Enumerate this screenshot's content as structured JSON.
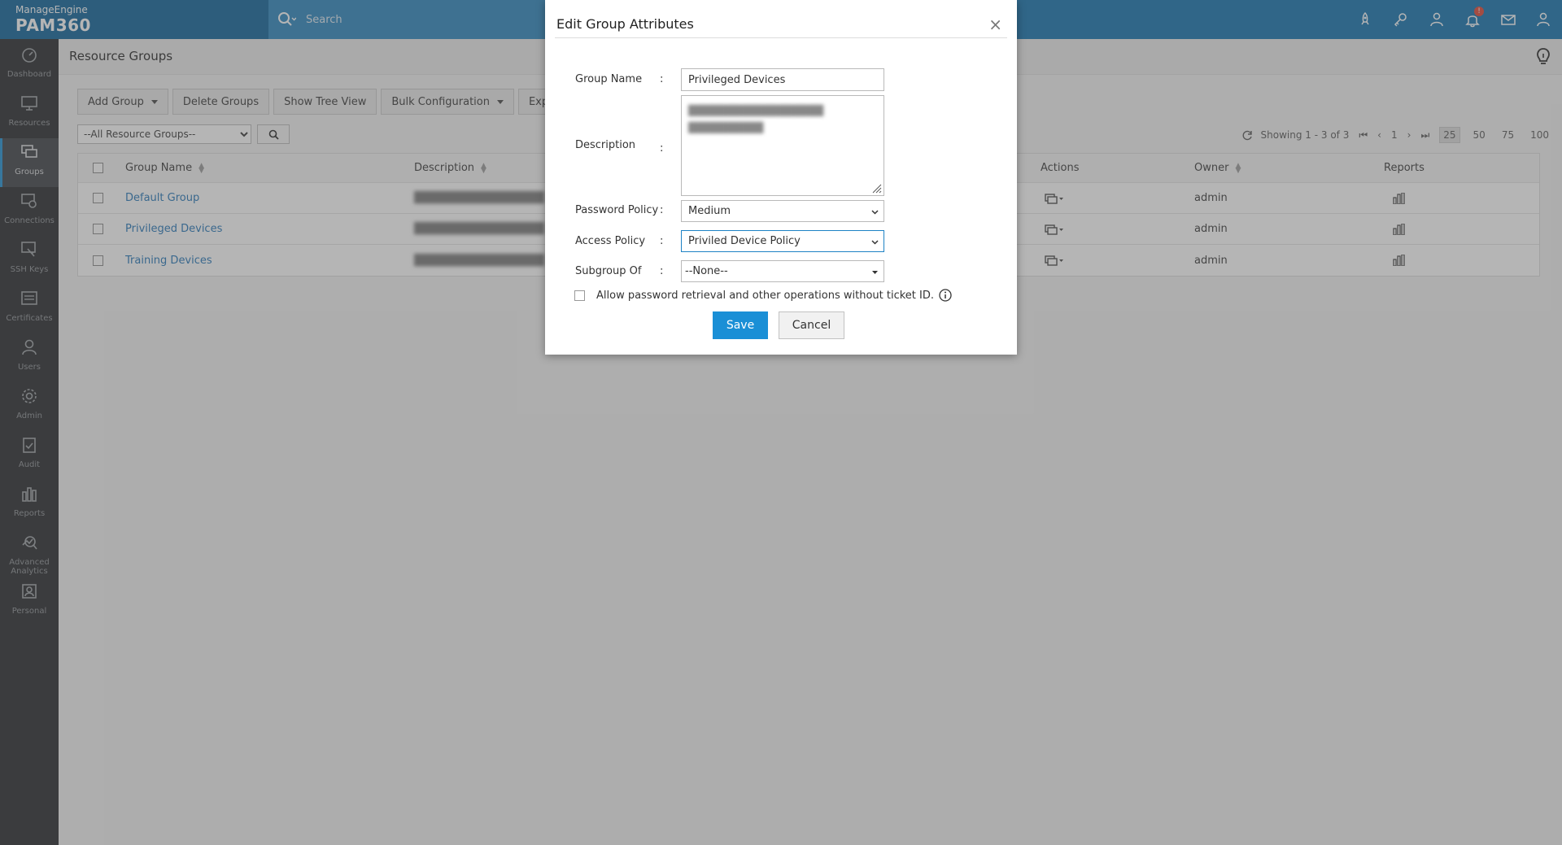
{
  "app": {
    "brand_top": "ManageEngine",
    "brand_name": "PAM360"
  },
  "search": {
    "placeholder": "Search"
  },
  "sidebar": {
    "items": [
      {
        "label": "Dashboard",
        "icon": "dashboard-icon"
      },
      {
        "label": "Resources",
        "icon": "monitor-icon"
      },
      {
        "label": "Groups",
        "icon": "groups-icon",
        "active": true
      },
      {
        "label": "Connections",
        "icon": "connections-icon"
      },
      {
        "label": "SSH Keys",
        "icon": "key-icon"
      },
      {
        "label": "Certificates",
        "icon": "certificate-icon"
      },
      {
        "label": "Users",
        "icon": "user-icon"
      },
      {
        "label": "Admin",
        "icon": "gear-icon"
      },
      {
        "label": "Audit",
        "icon": "clipboard-icon"
      },
      {
        "label": "Reports",
        "icon": "bar-chart-icon"
      },
      {
        "label": "Advanced Analytics",
        "icon": "analytics-icon"
      },
      {
        "label": "Personal",
        "icon": "personal-icon"
      }
    ]
  },
  "page": {
    "title": "Resource Groups"
  },
  "toolbar": {
    "add_group": "Add Group",
    "delete_groups": "Delete Groups",
    "show_tree_view": "Show Tree View",
    "bulk_configuration": "Bulk Configuration",
    "export": "Export"
  },
  "filter": {
    "selected": "--All Resource Groups--"
  },
  "pager": {
    "showing": "Showing 1 - 3 of 3",
    "page": "1",
    "sizes": [
      "25",
      "50",
      "75",
      "100"
    ],
    "selected_size": "25"
  },
  "table": {
    "headers": {
      "group_name": "Group Name",
      "description": "Description",
      "actions": "Actions",
      "owner": "Owner",
      "reports": "Reports"
    },
    "rows": [
      {
        "name": "Default Group",
        "owner": "admin"
      },
      {
        "name": "Privileged Devices",
        "owner": "admin"
      },
      {
        "name": "Training Devices",
        "owner": "admin"
      }
    ]
  },
  "modal": {
    "title": "Edit Group Attributes",
    "close": "×",
    "group_name_label": "Group Name",
    "group_name_value": "Privileged Devices",
    "description_label": "Description",
    "password_policy_label": "Password Policy",
    "password_policy_value": "Medium",
    "access_policy_label": "Access Policy",
    "access_policy_value": "Priviled Device Policy",
    "subgroup_label": "Subgroup Of",
    "subgroup_value": "--None--",
    "colon": ":",
    "checkbox_label": "Allow password retrieval and other operations without ticket ID.",
    "save": "Save",
    "cancel": "Cancel"
  },
  "colors": {
    "topbar": "#0d6fae",
    "sidebar": "#222427",
    "accent": "#1a8fd6",
    "link": "#1f73b7"
  }
}
